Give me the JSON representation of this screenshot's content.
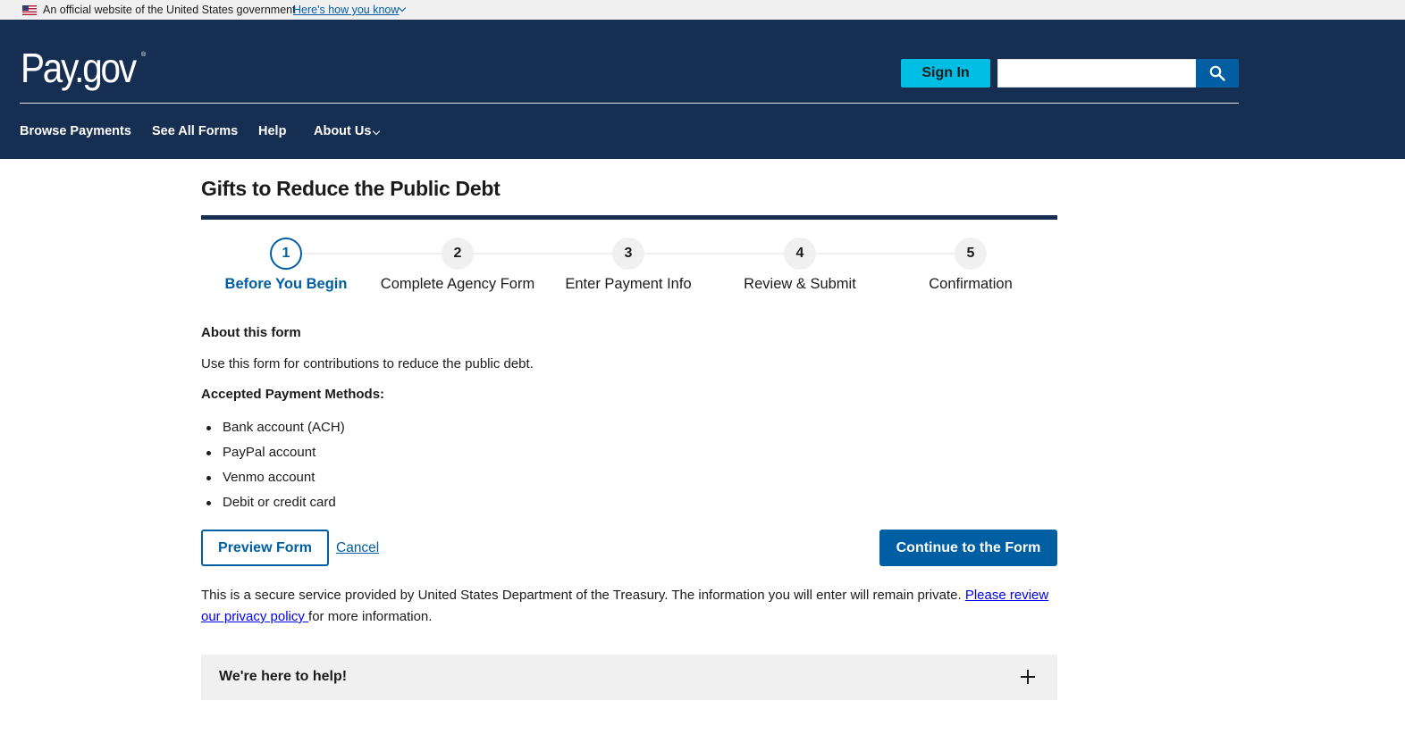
{
  "gov_banner": {
    "text": "An official website of the United States government",
    "link": "Here's how you know"
  },
  "header": {
    "logo": "Pay.gov",
    "logo_mark": "®",
    "sign_in": "Sign In",
    "search_value": ""
  },
  "nav": {
    "items": [
      "Browse Payments",
      "See All Forms",
      "Help",
      "About Us"
    ]
  },
  "main": {
    "title": "Gifts to Reduce the Public Debt",
    "steps": [
      {
        "number": "1",
        "label": "Before You Begin"
      },
      {
        "number": "2",
        "label": "Complete Agency Form"
      },
      {
        "number": "3",
        "label": "Enter Payment Info"
      },
      {
        "number": "4",
        "label": "Review & Submit"
      },
      {
        "number": "5",
        "label": "Confirmation"
      }
    ],
    "active_step": 1,
    "about_heading": "About this form",
    "about_text": "Use this form for contributions to reduce the public debt.",
    "methods_heading": "Accepted Payment Methods:",
    "methods": [
      "Bank account (ACH)",
      "PayPal account",
      "Venmo account",
      "Debit or credit card"
    ],
    "preview_button": "Preview Form",
    "cancel_link": "Cancel",
    "continue_button": "Continue to the Form",
    "secure_text": "This is a secure service provided by United States Department of the Treasury. The information you will enter will remain private. ",
    "privacy_link": "Please review our privacy policy ",
    "secure_tail": "for more information.",
    "help_title": "We're here to help!"
  },
  "icons": {
    "search": "search-icon",
    "help_toggle": "plus-icon",
    "flag": "us-flag-icon"
  },
  "colors": {
    "header_bg": "#162e51",
    "primary": "#005ea2",
    "sign_in_bg": "#00bde3"
  }
}
